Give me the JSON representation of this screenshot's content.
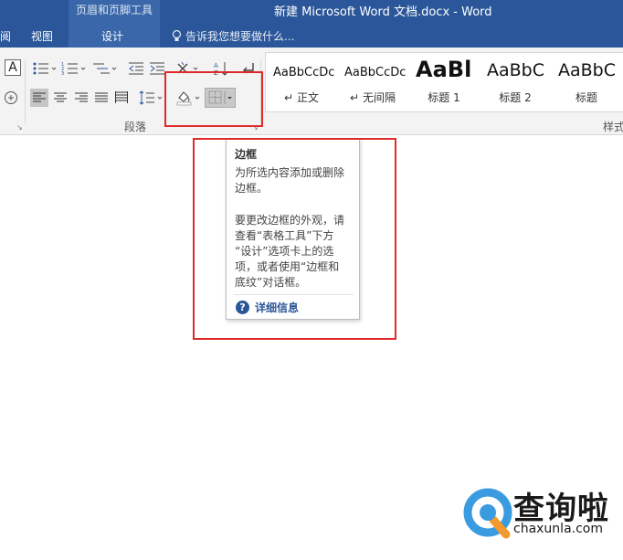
{
  "titlebar": {
    "context_group": "页眉和页脚工具",
    "document_title": "新建 Microsoft Word 文档.docx - Word",
    "tabs": [
      "阅",
      "视图",
      "设计"
    ],
    "tell_me": "告诉我您想要做什么..."
  },
  "ribbon": {
    "groups": {
      "paragraph": "段落",
      "styles": "样式"
    },
    "styles": [
      {
        "preview": "AaBbCcDc",
        "name": "正文",
        "marker": "↵"
      },
      {
        "preview": "AaBbCcDc",
        "name": "无间隔",
        "marker": "↵"
      },
      {
        "preview": "AaBl",
        "name": "标题 1"
      },
      {
        "preview": "AaBbC",
        "name": "标题 2"
      },
      {
        "preview": "AaBbC",
        "name": "标题"
      }
    ],
    "font_glyph": "A"
  },
  "tooltip": {
    "title": "边框",
    "desc_lines": [
      "为所选内容添加或删除",
      "边框。"
    ],
    "detail_lines": [
      "要更改边框的外观，请",
      "查看“表格工具”下方",
      "“设计”选项卡上的选",
      "项，或者使用“边框和",
      "底纹”对话框。"
    ],
    "more": "详细信息",
    "help_glyph": "?"
  },
  "watermark": {
    "brand": "查询啦",
    "url": "chaxunla.com"
  },
  "colors": {
    "ribbon_blue": "#2b579a",
    "highlight_red": "#e02a2a"
  },
  "icons": [
    "bulb-icon",
    "bullets-icon",
    "numbering-icon",
    "multilevel-list-icon",
    "decrease-indent-icon",
    "increase-indent-icon",
    "chinese-layout-icon",
    "sort-icon",
    "show-marks-icon",
    "align-left-icon",
    "center-icon",
    "align-right-icon",
    "justify-icon",
    "distributed-icon",
    "line-spacing-icon",
    "shading-icon",
    "borders-icon",
    "help-icon"
  ]
}
